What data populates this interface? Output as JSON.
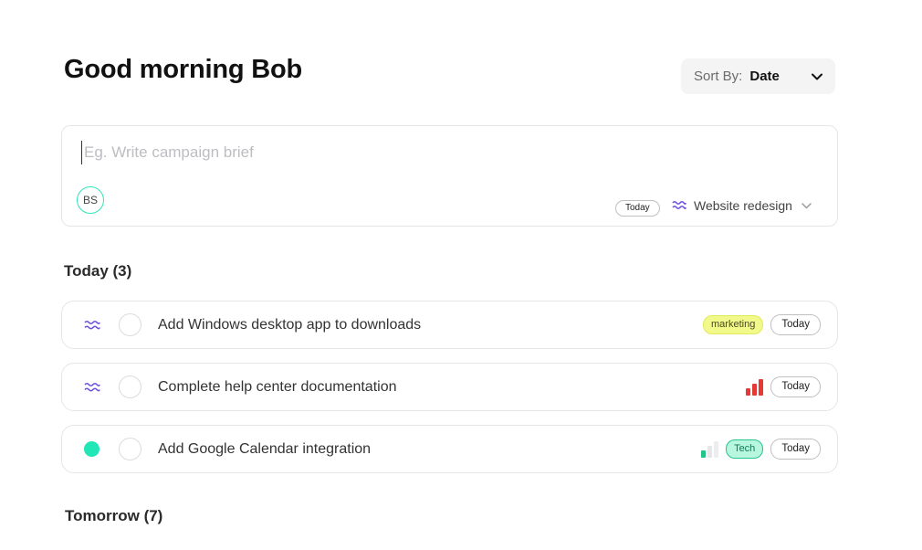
{
  "header": {
    "greeting": "Good morning Bob",
    "sort_label": "Sort By:",
    "sort_value": "Date"
  },
  "composer": {
    "placeholder": "Eg. Write campaign brief",
    "avatar_initials": "BS",
    "date_label": "Today",
    "project_label": "Website redesign",
    "project_icon": "waves-icon"
  },
  "sections": [
    {
      "title": "Today (3)",
      "tasks": [
        {
          "project_icon": "waves-icon",
          "title": "Add Windows desktop app to downloads",
          "tag": "marketing",
          "date": "Today"
        },
        {
          "project_icon": "waves-icon",
          "title": "Complete help center documentation",
          "priority": "high",
          "date": "Today"
        },
        {
          "project_icon": "green-dot-icon",
          "title": "Add Google Calendar integration",
          "priority": "low",
          "tag": "Tech",
          "date": "Today"
        }
      ]
    },
    {
      "title": "Tomorrow (7)"
    }
  ],
  "colors": {
    "accent_purple": "#6b4fe0",
    "avatar_ring": "#2ee6b9",
    "dot_green": "#21e6b5",
    "tag_marketing_bg": "#f0f98a",
    "tag_tech_bg": "#b8f7df",
    "priority_high": "#e53935",
    "priority_low": "#21c58a"
  }
}
